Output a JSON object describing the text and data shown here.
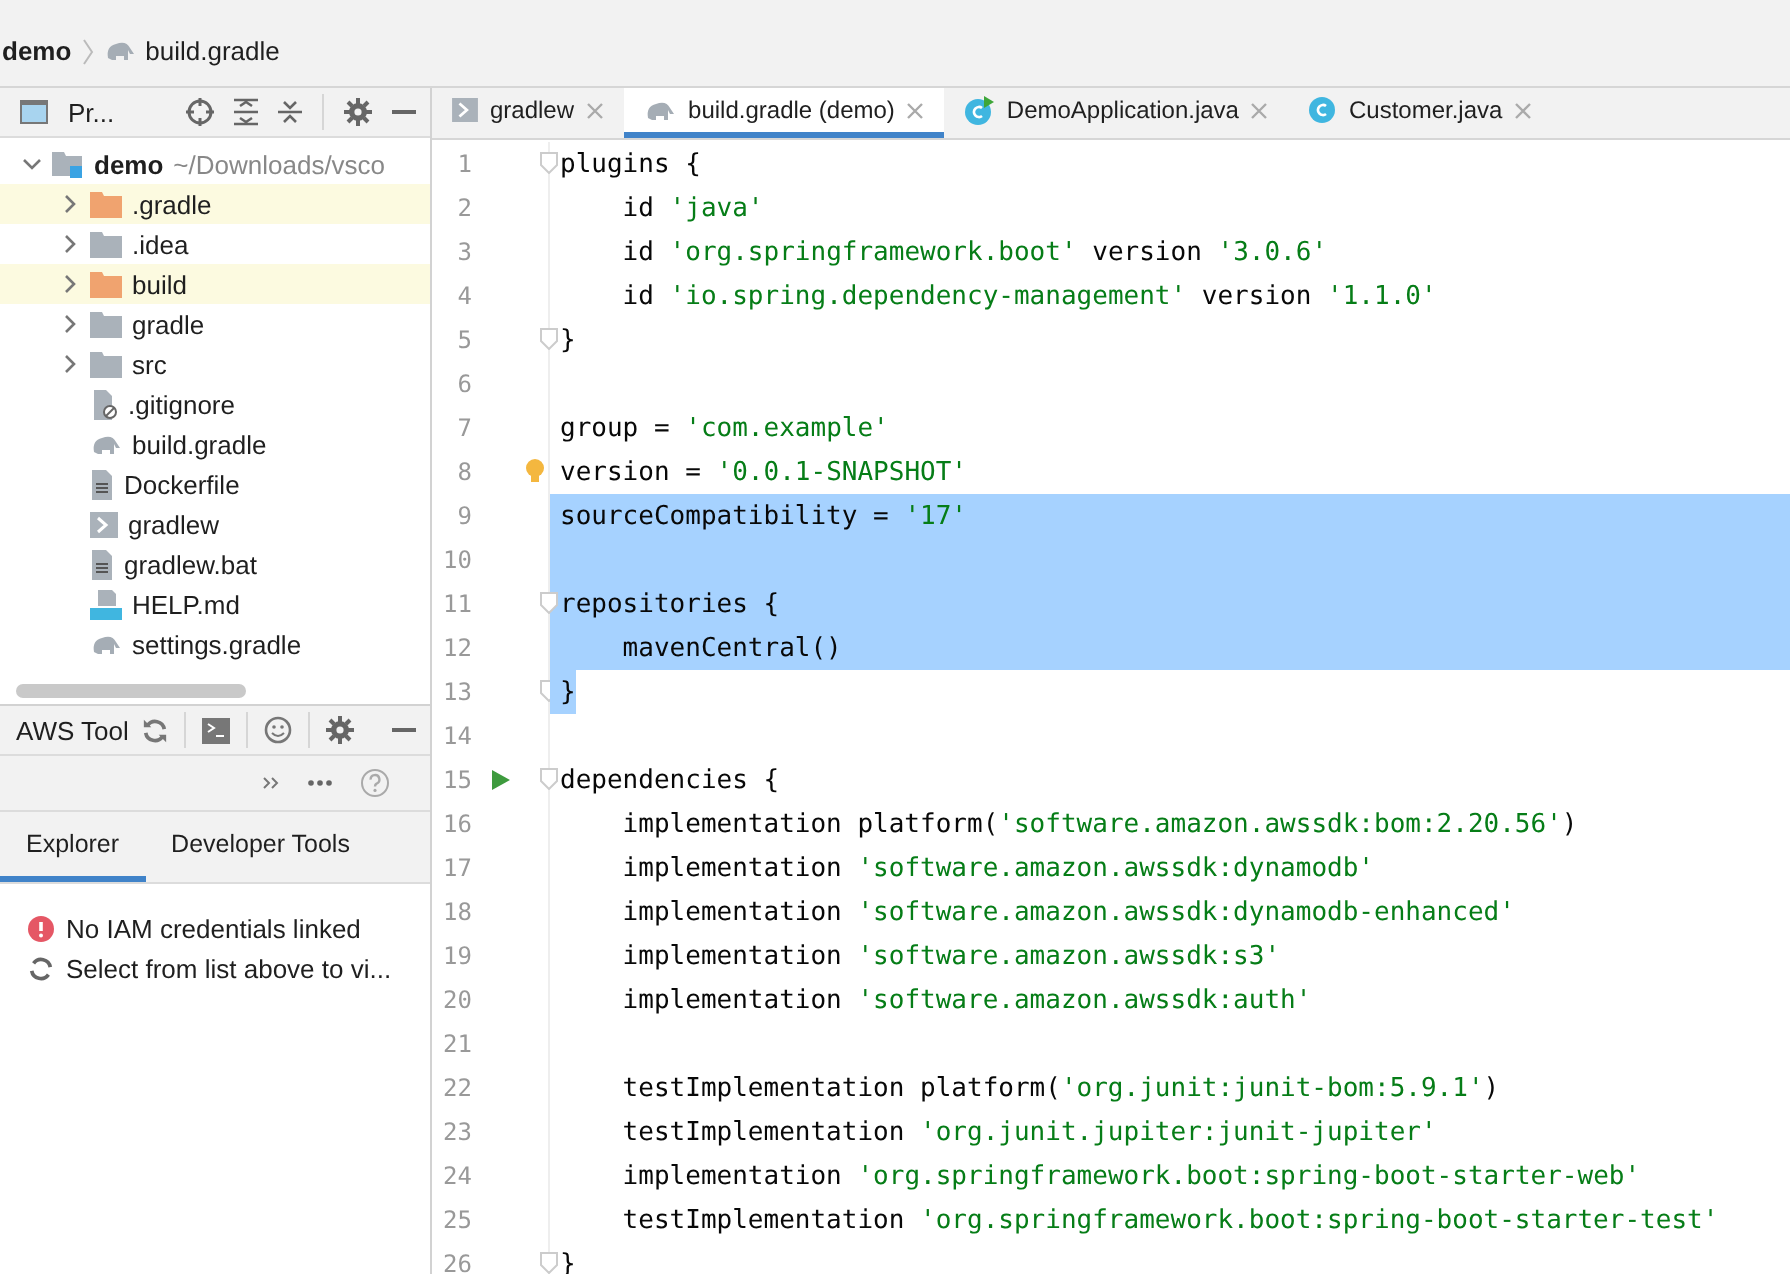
{
  "breadcrumb": [
    "demo",
    "build.gradle"
  ],
  "project_panel": {
    "title": "Pr...",
    "tree": [
      {
        "label": "demo",
        "hint": "~/Downloads/vsco",
        "kind": "module",
        "expanded": true,
        "children": [
          {
            "label": ".gradle",
            "kind": "folder",
            "expanded": false,
            "excluded": true
          },
          {
            "label": ".idea",
            "kind": "folder",
            "expanded": false,
            "excluded": false
          },
          {
            "label": "build",
            "kind": "folder",
            "expanded": false,
            "excluded": true
          },
          {
            "label": "gradle",
            "kind": "folder",
            "expanded": false,
            "excluded": false
          },
          {
            "label": "src",
            "kind": "folder",
            "expanded": false,
            "excluded": false
          },
          {
            "label": ".gitignore",
            "kind": "ignore"
          },
          {
            "label": "build.gradle",
            "kind": "gradle"
          },
          {
            "label": "Dockerfile",
            "kind": "text"
          },
          {
            "label": "gradlew",
            "kind": "shell"
          },
          {
            "label": "gradlew.bat",
            "kind": "text"
          },
          {
            "label": "HELP.md",
            "kind": "markdown"
          },
          {
            "label": "settings.gradle",
            "kind": "gradle"
          }
        ]
      }
    ]
  },
  "aws_panel": {
    "title": "AWS Tool",
    "tabs": [
      {
        "label": "Explorer",
        "selected": true
      },
      {
        "label": "Developer Tools",
        "selected": false
      }
    ],
    "messages": [
      {
        "text": "No IAM credentials linked",
        "kind": "error"
      },
      {
        "text": "Select from list above to vi...",
        "kind": "refresh"
      }
    ]
  },
  "editor_tabs": [
    {
      "label": "gradlew",
      "kind": "shell",
      "selected": false
    },
    {
      "label": "build.gradle (demo)",
      "kind": "gradle",
      "selected": true
    },
    {
      "label": "DemoApplication.java",
      "kind": "runnable-class",
      "selected": false
    },
    {
      "label": "Customer.java",
      "kind": "class",
      "selected": false
    }
  ],
  "code": [
    {
      "number": "1",
      "selected": false,
      "fold": true,
      "tokens": [
        {
          "text": "plugins {",
          "kind": "plain"
        }
      ]
    },
    {
      "number": "2",
      "selected": false,
      "tokens": [
        {
          "text": "    id ",
          "kind": "plain"
        },
        {
          "text": "'java'",
          "kind": "string"
        }
      ]
    },
    {
      "number": "3",
      "selected": false,
      "tokens": [
        {
          "text": "    id ",
          "kind": "plain"
        },
        {
          "text": "'org.springframework.boot'",
          "kind": "string"
        },
        {
          "text": " version ",
          "kind": "plain"
        },
        {
          "text": "'3.0.6'",
          "kind": "string"
        }
      ]
    },
    {
      "number": "4",
      "selected": false,
      "tokens": [
        {
          "text": "    id ",
          "kind": "plain"
        },
        {
          "text": "'io.spring.dependency-management'",
          "kind": "string"
        },
        {
          "text": " version ",
          "kind": "plain"
        },
        {
          "text": "'1.1.0'",
          "kind": "string"
        }
      ]
    },
    {
      "number": "5",
      "selected": false,
      "fold": true,
      "tokens": [
        {
          "text": "}",
          "kind": "plain"
        }
      ]
    },
    {
      "number": "6",
      "selected": false
    },
    {
      "number": "7",
      "selected": false,
      "tokens": [
        {
          "text": "group = ",
          "kind": "plain"
        },
        {
          "text": "'com.example'",
          "kind": "string"
        }
      ]
    },
    {
      "number": "8",
      "selected": false,
      "bulb": true,
      "tokens": [
        {
          "text": "version = ",
          "kind": "plain"
        },
        {
          "text": "'0.0.1-SNAPSHOT'",
          "kind": "string"
        }
      ]
    },
    {
      "number": "9",
      "selected": true,
      "tokens": [
        {
          "text": "sourceCompatibility = ",
          "kind": "plain"
        },
        {
          "text": "'17'",
          "kind": "string"
        }
      ]
    },
    {
      "number": "10",
      "selected": true
    },
    {
      "number": "11",
      "selected": true,
      "fold": true,
      "tokens": [
        {
          "text": "repositories {",
          "kind": "plain"
        }
      ]
    },
    {
      "number": "12",
      "selected": true,
      "tokens": [
        {
          "text": "    mavenCentral()",
          "kind": "plain"
        }
      ]
    },
    {
      "number": "13",
      "selected": true,
      "fold": true,
      "tokens": [
        {
          "text": "}",
          "kind": "plain"
        }
      ]
    },
    {
      "number": "14",
      "selected": false
    },
    {
      "number": "15",
      "selected": false,
      "run": true,
      "fold": true,
      "tokens": [
        {
          "text": "dependencies {",
          "kind": "plain"
        }
      ]
    },
    {
      "number": "16",
      "selected": false,
      "tokens": [
        {
          "text": "    implementation platform(",
          "kind": "plain"
        },
        {
          "text": "'software.amazon.awssdk:bom:2.20.56'",
          "kind": "string"
        },
        {
          "text": ")",
          "kind": "plain"
        }
      ]
    },
    {
      "number": "17",
      "selected": false,
      "tokens": [
        {
          "text": "    implementation ",
          "kind": "plain"
        },
        {
          "text": "'software.amazon.awssdk:dynamodb'",
          "kind": "string"
        }
      ]
    },
    {
      "number": "18",
      "selected": false,
      "tokens": [
        {
          "text": "    implementation ",
          "kind": "plain"
        },
        {
          "text": "'software.amazon.awssdk:dynamodb-enhanced'",
          "kind": "string"
        }
      ]
    },
    {
      "number": "19",
      "selected": false,
      "tokens": [
        {
          "text": "    implementation ",
          "kind": "plain"
        },
        {
          "text": "'software.amazon.awssdk:s3'",
          "kind": "string"
        }
      ]
    },
    {
      "number": "20",
      "selected": false,
      "tokens": [
        {
          "text": "    implementation ",
          "kind": "plain"
        },
        {
          "text": "'software.amazon.awssdk:auth'",
          "kind": "string"
        }
      ]
    },
    {
      "number": "21",
      "selected": false
    },
    {
      "number": "22",
      "selected": false,
      "tokens": [
        {
          "text": "    testImplementation platform(",
          "kind": "plain"
        },
        {
          "text": "'org.junit:junit-bom:5.9.1'",
          "kind": "string"
        },
        {
          "text": ")",
          "kind": "plain"
        }
      ]
    },
    {
      "number": "23",
      "selected": false,
      "tokens": [
        {
          "text": "    testImplementation ",
          "kind": "plain"
        },
        {
          "text": "'org.junit.jupiter:junit-jupiter'",
          "kind": "string"
        }
      ]
    },
    {
      "number": "24",
      "selected": false,
      "tokens": [
        {
          "text": "    implementation ",
          "kind": "plain"
        },
        {
          "text": "'org.springframework.boot:spring-boot-starter-web'",
          "kind": "string"
        }
      ]
    },
    {
      "number": "25",
      "selected": false,
      "tokens": [
        {
          "text": "    testImplementation ",
          "kind": "plain"
        },
        {
          "text": "'org.springframework.boot:spring-boot-starter-test'",
          "kind": "string"
        }
      ]
    },
    {
      "number": "26",
      "selected": false,
      "fold": true,
      "tokens": [
        {
          "text": "}",
          "kind": "plain"
        }
      ]
    }
  ]
}
